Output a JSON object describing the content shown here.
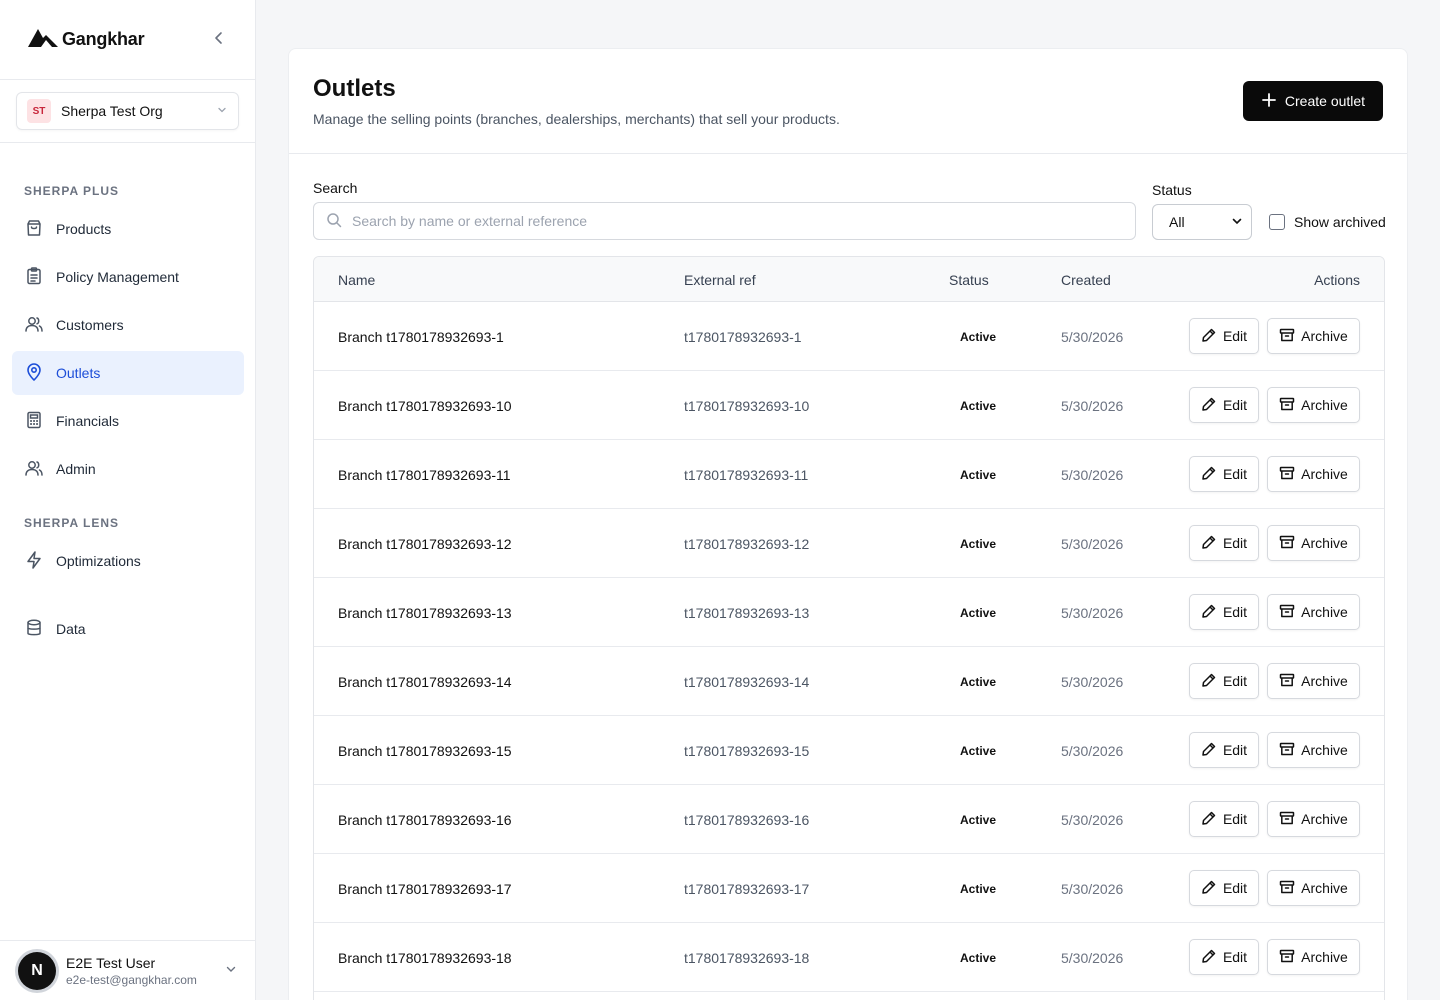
{
  "brand": {
    "name": "Gangkhar"
  },
  "org": {
    "initials": "ST",
    "name": "Sherpa Test Org"
  },
  "nav": {
    "sections": [
      {
        "title": "SHERPA PLUS"
      },
      {
        "title": "SHERPA LENS"
      }
    ],
    "items": [
      {
        "label": "Products",
        "icon": "shopping-bag-icon"
      },
      {
        "label": "Policy Management",
        "icon": "clipboard-icon"
      },
      {
        "label": "Customers",
        "icon": "users-icon"
      },
      {
        "label": "Outlets",
        "icon": "map-pin-icon",
        "active": true
      },
      {
        "label": "Financials",
        "icon": "calculator-icon"
      },
      {
        "label": "Admin",
        "icon": "users-icon"
      },
      {
        "label": "Optimizations",
        "icon": "zap-icon"
      },
      {
        "label": "Data",
        "icon": "database-icon"
      }
    ]
  },
  "user": {
    "initial": "N",
    "name": "E2E Test User",
    "email": "e2e-test@gangkhar.com"
  },
  "page": {
    "title": "Outlets",
    "subtitle": "Manage the selling points (branches, dealerships, merchants) that sell your products.",
    "create_label": "Create outlet"
  },
  "filters": {
    "search_label": "Search",
    "search_placeholder": "Search by name or external reference",
    "status_label": "Status",
    "status_value": "All",
    "show_archived_label": "Show archived"
  },
  "table": {
    "headers": {
      "name": "Name",
      "ref": "External ref",
      "status": "Status",
      "created": "Created",
      "actions": "Actions"
    },
    "edit_label": "Edit",
    "archive_label": "Archive",
    "rows": [
      {
        "name": "Branch t1780178932693-1",
        "ref": "t1780178932693-1",
        "status": "Active",
        "created": "5/30/2026"
      },
      {
        "name": "Branch t1780178932693-10",
        "ref": "t1780178932693-10",
        "status": "Active",
        "created": "5/30/2026"
      },
      {
        "name": "Branch t1780178932693-11",
        "ref": "t1780178932693-11",
        "status": "Active",
        "created": "5/30/2026"
      },
      {
        "name": "Branch t1780178932693-12",
        "ref": "t1780178932693-12",
        "status": "Active",
        "created": "5/30/2026"
      },
      {
        "name": "Branch t1780178932693-13",
        "ref": "t1780178932693-13",
        "status": "Active",
        "created": "5/30/2026"
      },
      {
        "name": "Branch t1780178932693-14",
        "ref": "t1780178932693-14",
        "status": "Active",
        "created": "5/30/2026"
      },
      {
        "name": "Branch t1780178932693-15",
        "ref": "t1780178932693-15",
        "status": "Active",
        "created": "5/30/2026"
      },
      {
        "name": "Branch t1780178932693-16",
        "ref": "t1780178932693-16",
        "status": "Active",
        "created": "5/30/2026"
      },
      {
        "name": "Branch t1780178932693-17",
        "ref": "t1780178932693-17",
        "status": "Active",
        "created": "5/30/2026"
      },
      {
        "name": "Branch t1780178932693-18",
        "ref": "t1780178932693-18",
        "status": "Active",
        "created": "5/30/2026"
      }
    ]
  }
}
